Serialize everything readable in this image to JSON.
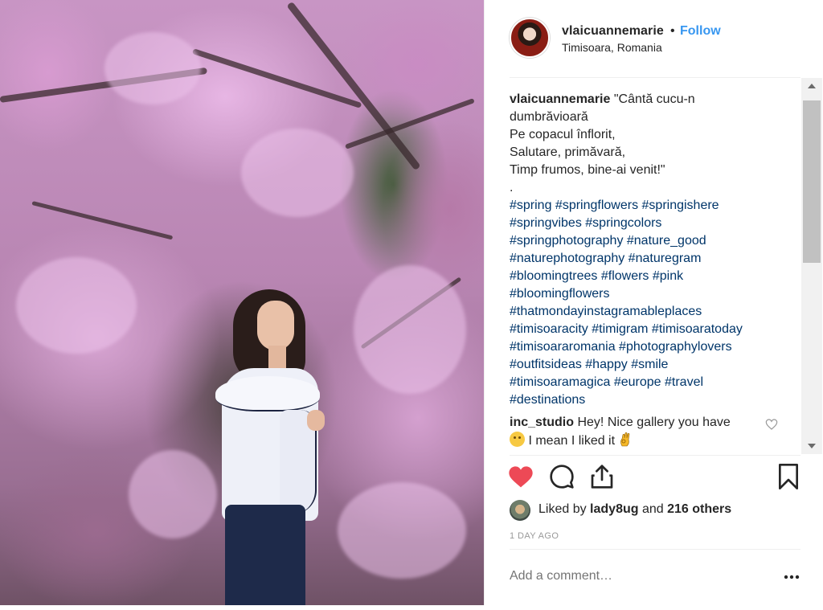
{
  "post": {
    "username": "vlaicuannemarie",
    "separator": "•",
    "follow_label": "Follow",
    "location": "Timisoara, Romania"
  },
  "caption": {
    "user": "vlaicuannemarie",
    "lines": [
      "\"Cântă cucu-n",
      "dumbrăvioară",
      "Pe copacul înflorit,",
      "Salutare, primăvară,",
      "Timp frumos, bine-ai venit!\"",
      "."
    ],
    "hashtag_lines": [
      "#spring #springflowers #springishere",
      "#springvibes #springcolors",
      "#springphotography #nature_good",
      "#naturephotography #naturegram",
      "#bloomingtrees #flowers #pink",
      "#bloomingflowers",
      "#thatmondayinstagramableplaces",
      "#timisoaracity #timigram #timisoaratoday",
      "#timisoararomania #photographylovers",
      "#outfitsideas #happy #smile",
      "#timisoaramagica #europe #travel",
      "#destinations"
    ]
  },
  "comment": {
    "user": "inc_studio",
    "text1": "Hey! Nice gallery you have",
    "text2": "I mean I liked it"
  },
  "likes": {
    "prefix": "Liked by",
    "user": "lady8ug",
    "conj": "and",
    "others": "216 others"
  },
  "timestamp": "1 DAY AGO",
  "add_comment": {
    "placeholder": "Add a comment…"
  },
  "colors": {
    "link": "#3897f0",
    "hashtag": "#003569",
    "liked_heart": "#ed4956",
    "muted": "#999999"
  },
  "icons": [
    "heart-icon",
    "comment-icon",
    "share-icon",
    "bookmark-icon",
    "more-icon",
    "small-heart-icon",
    "smiley-emoji",
    "ok-hand-emoji"
  ]
}
